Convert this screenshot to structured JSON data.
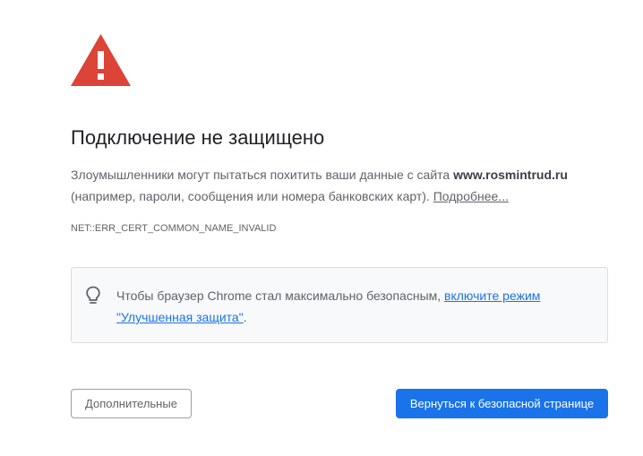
{
  "interstitial": {
    "icon": "warning-triangle-icon",
    "icon_color": "#db4437",
    "title": "Подключение не защищено",
    "message": {
      "prefix": "Злоумышленники могут пытаться похитить ваши данные с сайта ",
      "domain": "www.rosmintrud.ru",
      "suffix": " (например, пароли, сообщения или номера банковских карт). ",
      "details_link": "Подробнее..."
    },
    "error_code": "NET::ERR_CERT_COMMON_NAME_INVALID",
    "enhanced_protection": {
      "icon": "lightbulb-icon",
      "text": "Чтобы браузер Chrome стал максимально безопасным, ",
      "link": "включите режим \"Улучшенная защита\"",
      "period": "."
    },
    "buttons": {
      "advanced_label": "Дополнительные",
      "back_label": "Вернуться к безопасной странице"
    },
    "colors": {
      "primary": "#1a73e8",
      "text": "#202124",
      "secondary_text": "#5f6368"
    }
  }
}
